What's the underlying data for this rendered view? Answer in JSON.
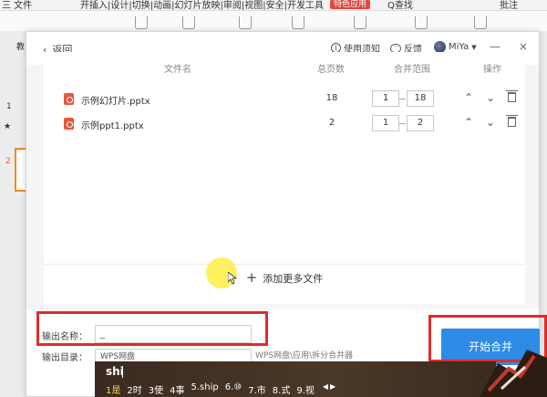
{
  "ribbon": {
    "file_menu": "三 文件",
    "menu_items": "开插入|设计|切换|动画|幻灯片放映|审阅|视图|安全|开发工具",
    "special_tab": "特色应用",
    "search": "Q查找",
    "comment": "批注",
    "left_label": "教"
  },
  "slides_panel": {
    "slide1": "1",
    "slide2": "2",
    "star": "★"
  },
  "dialog": {
    "back_label": "返回",
    "help_label": "使用须知",
    "feedback_label": "反馈",
    "user_name": "MiYa",
    "columns": {
      "file_name": "文件名",
      "total_pages": "总页数",
      "merge_range": "合并范围",
      "actions": "操作"
    },
    "files": [
      {
        "name": "示例幻灯片.pptx",
        "pages": "18",
        "range_start": "1",
        "range_end": "18"
      },
      {
        "name": "示例ppt1.pptx",
        "pages": "2",
        "range_start": "1",
        "range_end": "2"
      }
    ],
    "add_more_label": "添加更多文件",
    "output_name_label": "输出名称：",
    "output_name_value": "_",
    "output_dir_label": "输出目录：",
    "output_dir_value": "WPS网盘",
    "output_dir_hint": "WPS网盘\\应用\\拆分合并器",
    "start_button": "开始合并"
  },
  "ime": {
    "pinyin": "shi",
    "candidates": [
      "1是",
      "2时",
      "3使",
      "4事",
      "5.ship",
      "6.⑩",
      "7.市",
      "8.式",
      "9.视"
    ]
  },
  "colors": {
    "accent_blue": "#2e8be6",
    "annotation_red": "#e02b2b",
    "ppt_orange": "#e8563d"
  }
}
